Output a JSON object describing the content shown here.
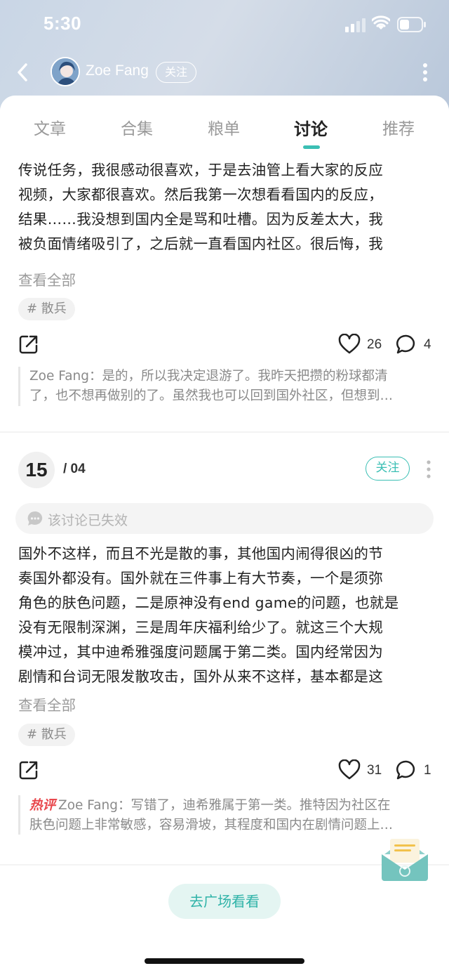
{
  "status": {
    "time": "5:30"
  },
  "header": {
    "author": "Zoe Fang",
    "follow_label": "关注"
  },
  "tabs": [
    {
      "label": "文章"
    },
    {
      "label": "合集"
    },
    {
      "label": "粮单"
    },
    {
      "label": "讨论"
    },
    {
      "label": "推荐"
    }
  ],
  "active_tab": "讨论",
  "post1": {
    "lines": [
      "传说任务，我很感动很喜欢，于是去油管上看大家的反应",
      "视频，大家都很喜欢。然后我第一次想看看国内的反应，",
      "结果……我没想到国内全是骂和吐槽。因为反差太大，我",
      "被负面情绪吸引了，之后就一直看国内社区。很后悔，我"
    ],
    "view_all": "查看全部",
    "tag": "# 散兵",
    "likes": "26",
    "comments": "4",
    "reply": {
      "line1": "Zoe Fang：是的，所以我决定退游了。我昨天把攒的粉球都清",
      "line2": "了，也不想再做别的了。虽然我也可以回到国外社区，但想到…"
    }
  },
  "post2": {
    "index": "15",
    "total": "/ 04",
    "follow_label": "关注",
    "invalid_notice": "该讨论已失效",
    "lines": [
      "国外不这样，而且不光是散的事，其他国内闹得很凶的节",
      "奏国外都没有。国外就在三件事上有大节奏，一个是须弥",
      "角色的肤色问题，二是原神没有end game的问题，也就是",
      "没有无限制深渊，三是周年庆福利给少了。就这三个大规",
      "模冲过，其中迪希雅强度问题属于第二类。国内经常因为",
      "剧情和台词无限发散攻击，国外从来不这样，基本都是这"
    ],
    "view_all": "查看全部",
    "tag": "# 散兵",
    "likes": "31",
    "comments": "1",
    "reply": {
      "badge": "热评",
      "line1": "Zoe Fang：写错了，迪希雅属于第一类。推特因为社区在",
      "line2": "肤色问题上非常敏感，容易滑坡，其程度和国内在剧情问题上…"
    }
  },
  "bottom": {
    "plaza_button": "去广场看看"
  },
  "colors": {
    "accent": "#3bbfb4",
    "hot": "#e8484d"
  }
}
